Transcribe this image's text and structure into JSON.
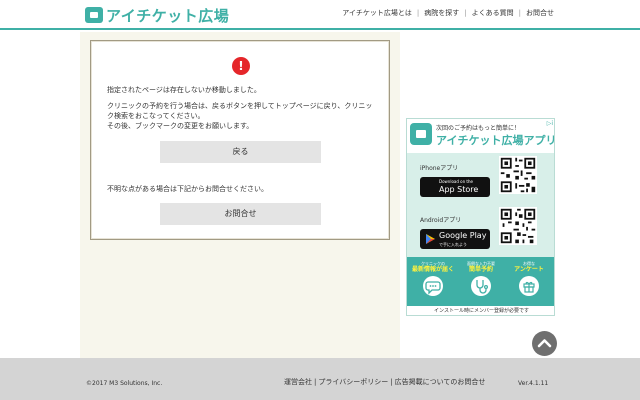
{
  "header": {
    "logo_text": "アイチケット広場",
    "nav": [
      {
        "label": "アイチケット広場とは"
      },
      {
        "label": "病院を探す"
      },
      {
        "label": "よくある質問"
      },
      {
        "label": "お問合せ"
      }
    ],
    "accent_color": "#3fb0a6"
  },
  "error": {
    "icon": "alert-icon",
    "message1": "指定されたページは存在しないか移動しました。",
    "message2": "クリニックの予約を行う場合は、戻るボタンを押してトップページに戻り、クリニック検索をおこなってください。\nその後、ブックマークの変更をお願いします。",
    "back_label": "戻る",
    "message3": "不明な点がある場合は下記からお問合せください。",
    "contact_label": "お問合せ"
  },
  "banner": {
    "subtitle": "次回のご予約はもっと簡単に！",
    "title": "アイチケット広場アプリ",
    "ios_label": "iPhoneアプリ",
    "ios_store_small": "Download on the",
    "ios_store_big": "App Store",
    "android_label": "Androidアプリ",
    "android_store_big": "Google Play",
    "android_store_small": "で手に入れよう",
    "features": [
      {
        "small": "クリニックの",
        "big": "最新情報が届く",
        "icon": "chat-icon"
      },
      {
        "small": "面倒な入力不要",
        "big": "簡単予約",
        "icon": "stethoscope-icon"
      },
      {
        "small": "お得な",
        "big": "アンケート",
        "icon": "gift-icon"
      }
    ],
    "note": "インストール時にメンバー登録が必要です"
  },
  "footer": {
    "copyright": "©2017 M3 Solutions, Inc.",
    "links": [
      {
        "label": "運営会社"
      },
      {
        "label": "プライバシーポリシー"
      },
      {
        "label": "広告掲載についてのお問合せ"
      }
    ],
    "version": "Ver.4.1.11"
  }
}
